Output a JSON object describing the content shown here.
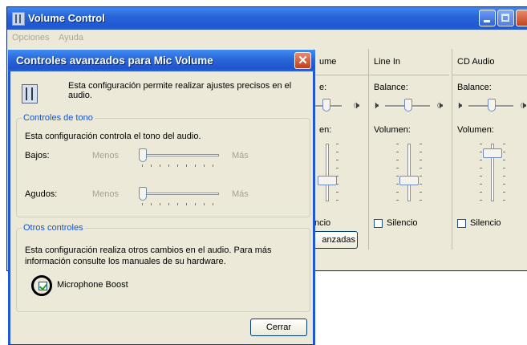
{
  "bg_window": {
    "title": "Volume Control",
    "menu": [
      "Opciones",
      "Ayuda"
    ],
    "channels": [
      {
        "name": "ume",
        "balance_label": "e:",
        "volume_label": "en:",
        "mute_label": "ncio",
        "mute_checked": false,
        "volume_level": 0.35
      },
      {
        "name": "Line In",
        "balance_label": "Balance:",
        "volume_label": "Volumen:",
        "mute_label": "Silencio",
        "mute_checked": false,
        "volume_level": 0.35
      },
      {
        "name": "CD Audio",
        "balance_label": "Balance:",
        "volume_label": "Volumen:",
        "mute_label": "Silencio",
        "mute_checked": false,
        "volume_level": 0.9
      }
    ],
    "advanced_button": "anzadas"
  },
  "dialog": {
    "title": "Controles avanzados para Mic Volume",
    "description": "Esta configuración permite realizar ajustes precisos en el audio.",
    "tone_group": {
      "legend": "Controles de tono",
      "description": "Esta configuración controla el tono del audio.",
      "bass": {
        "label": "Bajos:",
        "min": "Menos",
        "max": "Más",
        "value": 0.0
      },
      "treble": {
        "label": "Agudos:",
        "min": "Menos",
        "max": "Más",
        "value": 0.0
      }
    },
    "other_group": {
      "legend": "Otros controles",
      "description_line1": "Esta configuración realiza otros cambios en el audio. Para más",
      "description_line2": "información consulte los manuales de su hardware.",
      "boost_label": "Microphone Boost",
      "boost_checked": true
    },
    "close_button": "Cerrar"
  },
  "icons": {
    "app": "volume-control-icon",
    "dialog_info": "mixer-icon",
    "speaker": "speaker-icon"
  }
}
